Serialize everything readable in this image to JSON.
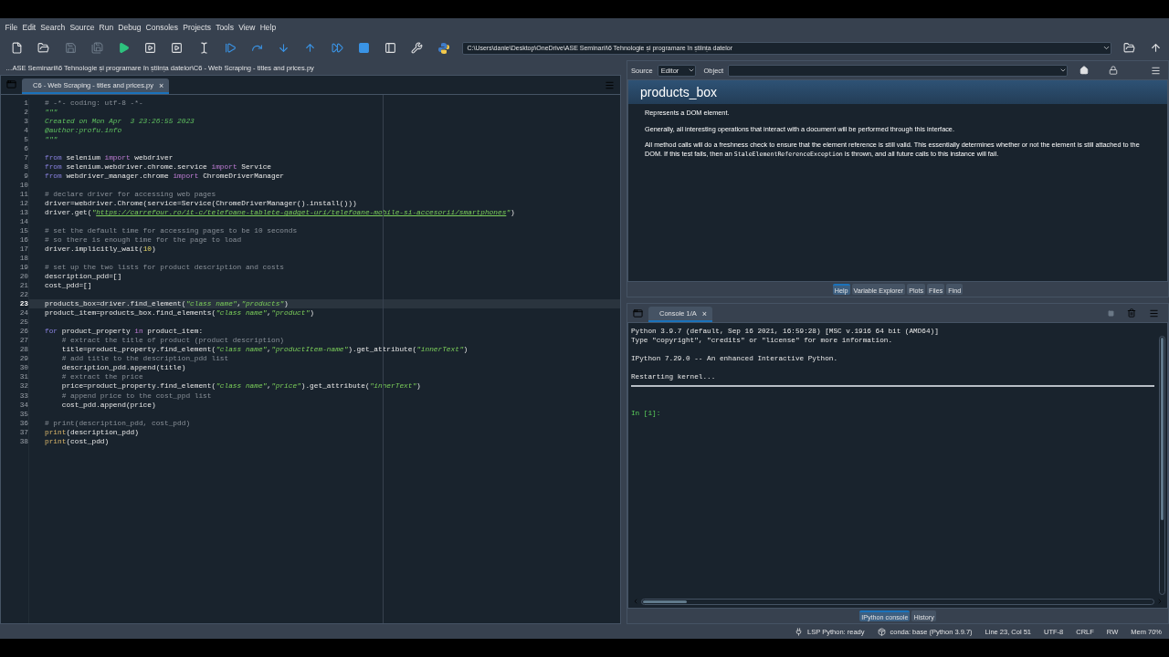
{
  "menu": [
    "File",
    "Edit",
    "Search",
    "Source",
    "Run",
    "Debug",
    "Consoles",
    "Projects",
    "Tools",
    "View",
    "Help"
  ],
  "toolbar": {
    "path": "C:\\Users\\danie\\Desktop\\OneDrive\\ASE Seminarii\\6 Tehnologie și programare în știința datelor"
  },
  "file_path": "…ASE Seminarii\\6 Tehnologie și programare în știința datelor\\C6 - Web Scraping - titles and prices.py",
  "editor": {
    "tab": {
      "label": "C6 - Web Scraping - titles and prices.py",
      "close": "×",
      "selected": true
    },
    "lines": [
      {
        "number": "1",
        "current": false,
        "tokens": [
          {
            "kind": "comment",
            "text": "# -*- coding: utf-8 -*-"
          }
        ]
      },
      {
        "number": "2",
        "current": false,
        "tokens": [
          {
            "kind": "doc",
            "text": "\"\"\""
          }
        ]
      },
      {
        "number": "3",
        "current": false,
        "tokens": [
          {
            "kind": "doc",
            "text": "Created on Mon Apr  3 23:26:55 2023"
          }
        ]
      },
      {
        "number": "4",
        "current": false,
        "tokens": [
          {
            "kind": "doc",
            "text": "@author:profu.info"
          }
        ]
      },
      {
        "number": "5",
        "current": false,
        "tokens": [
          {
            "kind": "doc",
            "text": "\"\"\""
          }
        ]
      },
      {
        "number": "6",
        "current": false
      },
      {
        "number": "7",
        "current": false,
        "tokens": [
          {
            "kind": "keyword",
            "text": "from"
          },
          {
            "kind": "plain",
            "text": " selenium "
          },
          {
            "kind": "keyword2",
            "text": "import"
          },
          {
            "kind": "plain",
            "text": " webdriver"
          }
        ]
      },
      {
        "number": "8",
        "current": false,
        "tokens": [
          {
            "kind": "keyword",
            "text": "from"
          },
          {
            "kind": "plain",
            "text": " selenium.webdriver.chrome.service "
          },
          {
            "kind": "keyword2",
            "text": "import"
          },
          {
            "kind": "plain",
            "text": " Service"
          }
        ]
      },
      {
        "number": "9",
        "current": false,
        "tokens": [
          {
            "kind": "keyword",
            "text": "from"
          },
          {
            "kind": "plain",
            "text": " webdriver_manager.chrome "
          },
          {
            "kind": "keyword2",
            "text": "import"
          },
          {
            "kind": "plain",
            "text": " ChromeDriverManager"
          }
        ]
      },
      {
        "number": "10",
        "current": false
      },
      {
        "number": "11",
        "current": false,
        "tokens": [
          {
            "kind": "comment",
            "text": "# declare driver for accessing web pages"
          }
        ]
      },
      {
        "number": "12",
        "current": false,
        "tokens": [
          {
            "kind": "plain",
            "text": "driver=webdriver.Chrome(service=Service(ChromeDriverManager().install()))"
          }
        ]
      },
      {
        "number": "13",
        "current": false,
        "tokens": [
          {
            "kind": "plain",
            "text": "driver.get("
          },
          {
            "kind": "string",
            "text": "\""
          },
          {
            "kind": "url",
            "text": "https://carrefour.ro/it-c/telefoane-tablete-gadget-uri/telefoane-mobile-si-accesorii/smartphones"
          },
          {
            "kind": "string",
            "text": "\""
          },
          {
            "kind": "plain",
            "text": ")"
          }
        ]
      },
      {
        "number": "14",
        "current": false
      },
      {
        "number": "15",
        "current": false,
        "tokens": [
          {
            "kind": "comment",
            "text": "# set the default time for accessing pages to be 10 seconds"
          }
        ]
      },
      {
        "number": "16",
        "current": false,
        "tokens": [
          {
            "kind": "comment",
            "text": "# so there is enough time for the page to load"
          }
        ]
      },
      {
        "number": "17",
        "current": false,
        "tokens": [
          {
            "kind": "plain",
            "text": "driver.implicitly_wait("
          },
          {
            "kind": "number",
            "text": "10"
          },
          {
            "kind": "plain",
            "text": ")"
          }
        ]
      },
      {
        "number": "18",
        "current": false
      },
      {
        "number": "19",
        "current": false,
        "tokens": [
          {
            "kind": "comment",
            "text": "# set up the two lists for product description and costs"
          }
        ]
      },
      {
        "number": "20",
        "current": false,
        "tokens": [
          {
            "kind": "plain",
            "text": "description_pdd=[]"
          }
        ]
      },
      {
        "number": "21",
        "current": false,
        "tokens": [
          {
            "kind": "plain",
            "text": "cost_pdd=[]"
          }
        ]
      },
      {
        "number": "22",
        "current": false
      },
      {
        "number": "23",
        "current": true,
        "tokens": [
          {
            "kind": "plain",
            "text": "products_box=driver.find_element("
          },
          {
            "kind": "string",
            "text": "\"class name\""
          },
          {
            "kind": "plain",
            "text": ","
          },
          {
            "kind": "string",
            "text": "\"products\""
          },
          {
            "kind": "plain",
            "text": ")"
          }
        ]
      },
      {
        "number": "24",
        "current": false,
        "tokens": [
          {
            "kind": "plain",
            "text": "product_item=products_box.find_elements("
          },
          {
            "kind": "string",
            "text": "\"class name\""
          },
          {
            "kind": "plain",
            "text": ","
          },
          {
            "kind": "string",
            "text": "\"product\""
          },
          {
            "kind": "plain",
            "text": ")"
          }
        ]
      },
      {
        "number": "25",
        "current": false
      },
      {
        "number": "26",
        "current": false,
        "tokens": [
          {
            "kind": "keyword",
            "text": "for"
          },
          {
            "kind": "plain",
            "text": " product_property "
          },
          {
            "kind": "keyword2",
            "text": "in"
          },
          {
            "kind": "plain",
            "text": " product_item:"
          }
        ]
      },
      {
        "number": "27",
        "current": false,
        "tokens": [
          {
            "kind": "comment",
            "text": "    # extract the title of product (product description)"
          }
        ]
      },
      {
        "number": "28",
        "current": false,
        "tokens": [
          {
            "kind": "plain",
            "text": "    title=product_property.find_element("
          },
          {
            "kind": "string",
            "text": "\"class name\""
          },
          {
            "kind": "plain",
            "text": ","
          },
          {
            "kind": "string",
            "text": "\"productItem-name\""
          },
          {
            "kind": "plain",
            "text": ").get_attribute("
          },
          {
            "kind": "string",
            "text": "\"innerText\""
          },
          {
            "kind": "plain",
            "text": ")"
          }
        ]
      },
      {
        "number": "29",
        "current": false,
        "tokens": [
          {
            "kind": "comment",
            "text": "    # add title to the description_pdd list"
          }
        ]
      },
      {
        "number": "30",
        "current": false,
        "tokens": [
          {
            "kind": "plain",
            "text": "    description_pdd.append(title)"
          }
        ]
      },
      {
        "number": "31",
        "current": false,
        "tokens": [
          {
            "kind": "comment",
            "text": "    # extract the price"
          }
        ]
      },
      {
        "number": "32",
        "current": false,
        "tokens": [
          {
            "kind": "plain",
            "text": "    price=product_property.find_element("
          },
          {
            "kind": "string",
            "text": "\"class name\""
          },
          {
            "kind": "plain",
            "text": ","
          },
          {
            "kind": "string",
            "text": "\"price\""
          },
          {
            "kind": "plain",
            "text": ").get_attribute("
          },
          {
            "kind": "string",
            "text": "\"innerText\""
          },
          {
            "kind": "plain",
            "text": ")"
          }
        ]
      },
      {
        "number": "33",
        "current": false,
        "tokens": [
          {
            "kind": "comment",
            "text": "    # append price to the cost_ppd list"
          }
        ]
      },
      {
        "number": "34",
        "current": false,
        "tokens": [
          {
            "kind": "plain",
            "text": "    cost_pdd.append(price)"
          }
        ]
      },
      {
        "number": "35",
        "current": false
      },
      {
        "number": "36",
        "current": false,
        "tokens": [
          {
            "kind": "comment",
            "text": "# print(description_pdd, cost_pdd)"
          }
        ]
      },
      {
        "number": "37",
        "current": false,
        "tokens": [
          {
            "kind": "builtin",
            "text": "print"
          },
          {
            "kind": "plain",
            "text": "(description_pdd)"
          }
        ]
      },
      {
        "number": "38",
        "current": false,
        "tokens": [
          {
            "kind": "builtin",
            "text": "print"
          },
          {
            "kind": "plain",
            "text": "(cost_pdd)"
          }
        ]
      }
    ]
  },
  "help_pane": {
    "source_label": "Source",
    "source_value": "Editor",
    "object_label": "Object",
    "title": "products_box",
    "paragraphs": [
      {
        "parts": [
          {
            "kind": "text",
            "text": "Represents a DOM element."
          }
        ]
      },
      {
        "parts": [
          {
            "kind": "text",
            "text": "Generally, all interesting operations that interact with a document will be performed through this interface."
          }
        ]
      },
      {
        "parts": [
          {
            "kind": "text",
            "text": "All method calls will do a freshness check to ensure that the element reference is still valid. This essentially determines whether or not the element is still attached to the DOM. If this test fails, then an "
          },
          {
            "kind": "code",
            "text": "StaleElementReferenceException"
          },
          {
            "kind": "text",
            "text": " is thrown, and all future calls to this instance will fail."
          }
        ]
      }
    ],
    "tabs": [
      {
        "label": "Help",
        "selected": true
      },
      {
        "label": "Variable Explorer",
        "selected": false
      },
      {
        "label": "Plots",
        "selected": false
      },
      {
        "label": "Files",
        "selected": false
      },
      {
        "label": "Find",
        "selected": false
      }
    ]
  },
  "console_pane": {
    "tab": {
      "label": "Console 1/A",
      "close": "×",
      "selected": true
    },
    "lines": [
      {
        "kind": "output",
        "text": "Python 3.9.7 (default, Sep 16 2021, 16:59:28) [MSC v.1916 64 bit (AMD64)]"
      },
      {
        "kind": "output",
        "text": "Type \"copyright\", \"credits\" or \"license\" for more information."
      },
      {
        "kind": "blank"
      },
      {
        "kind": "output",
        "text": "IPython 7.29.0 -- An enhanced Interactive Python."
      },
      {
        "kind": "blank"
      },
      {
        "kind": "output",
        "text": "Restarting kernel..."
      },
      {
        "kind": "rule"
      },
      {
        "kind": "blank"
      },
      {
        "kind": "blank"
      },
      {
        "kind": "prompt",
        "text": "In [1]:"
      }
    ],
    "tabs": [
      {
        "label": "IPython console",
        "selected": true
      },
      {
        "label": "History",
        "selected": false
      }
    ]
  },
  "status_bar": [
    {
      "kind": "lsp",
      "text": "LSP Python: ready"
    },
    {
      "kind": "conda",
      "text": "conda: base (Python 3.9.7)"
    },
    {
      "kind": "plain",
      "text": "Line 23, Col 51"
    },
    {
      "kind": "plain",
      "text": "UTF-8"
    },
    {
      "kind": "plain",
      "text": "CRLF"
    },
    {
      "kind": "plain",
      "text": "RW"
    },
    {
      "kind": "plain",
      "text": "Mem 70%"
    }
  ]
}
